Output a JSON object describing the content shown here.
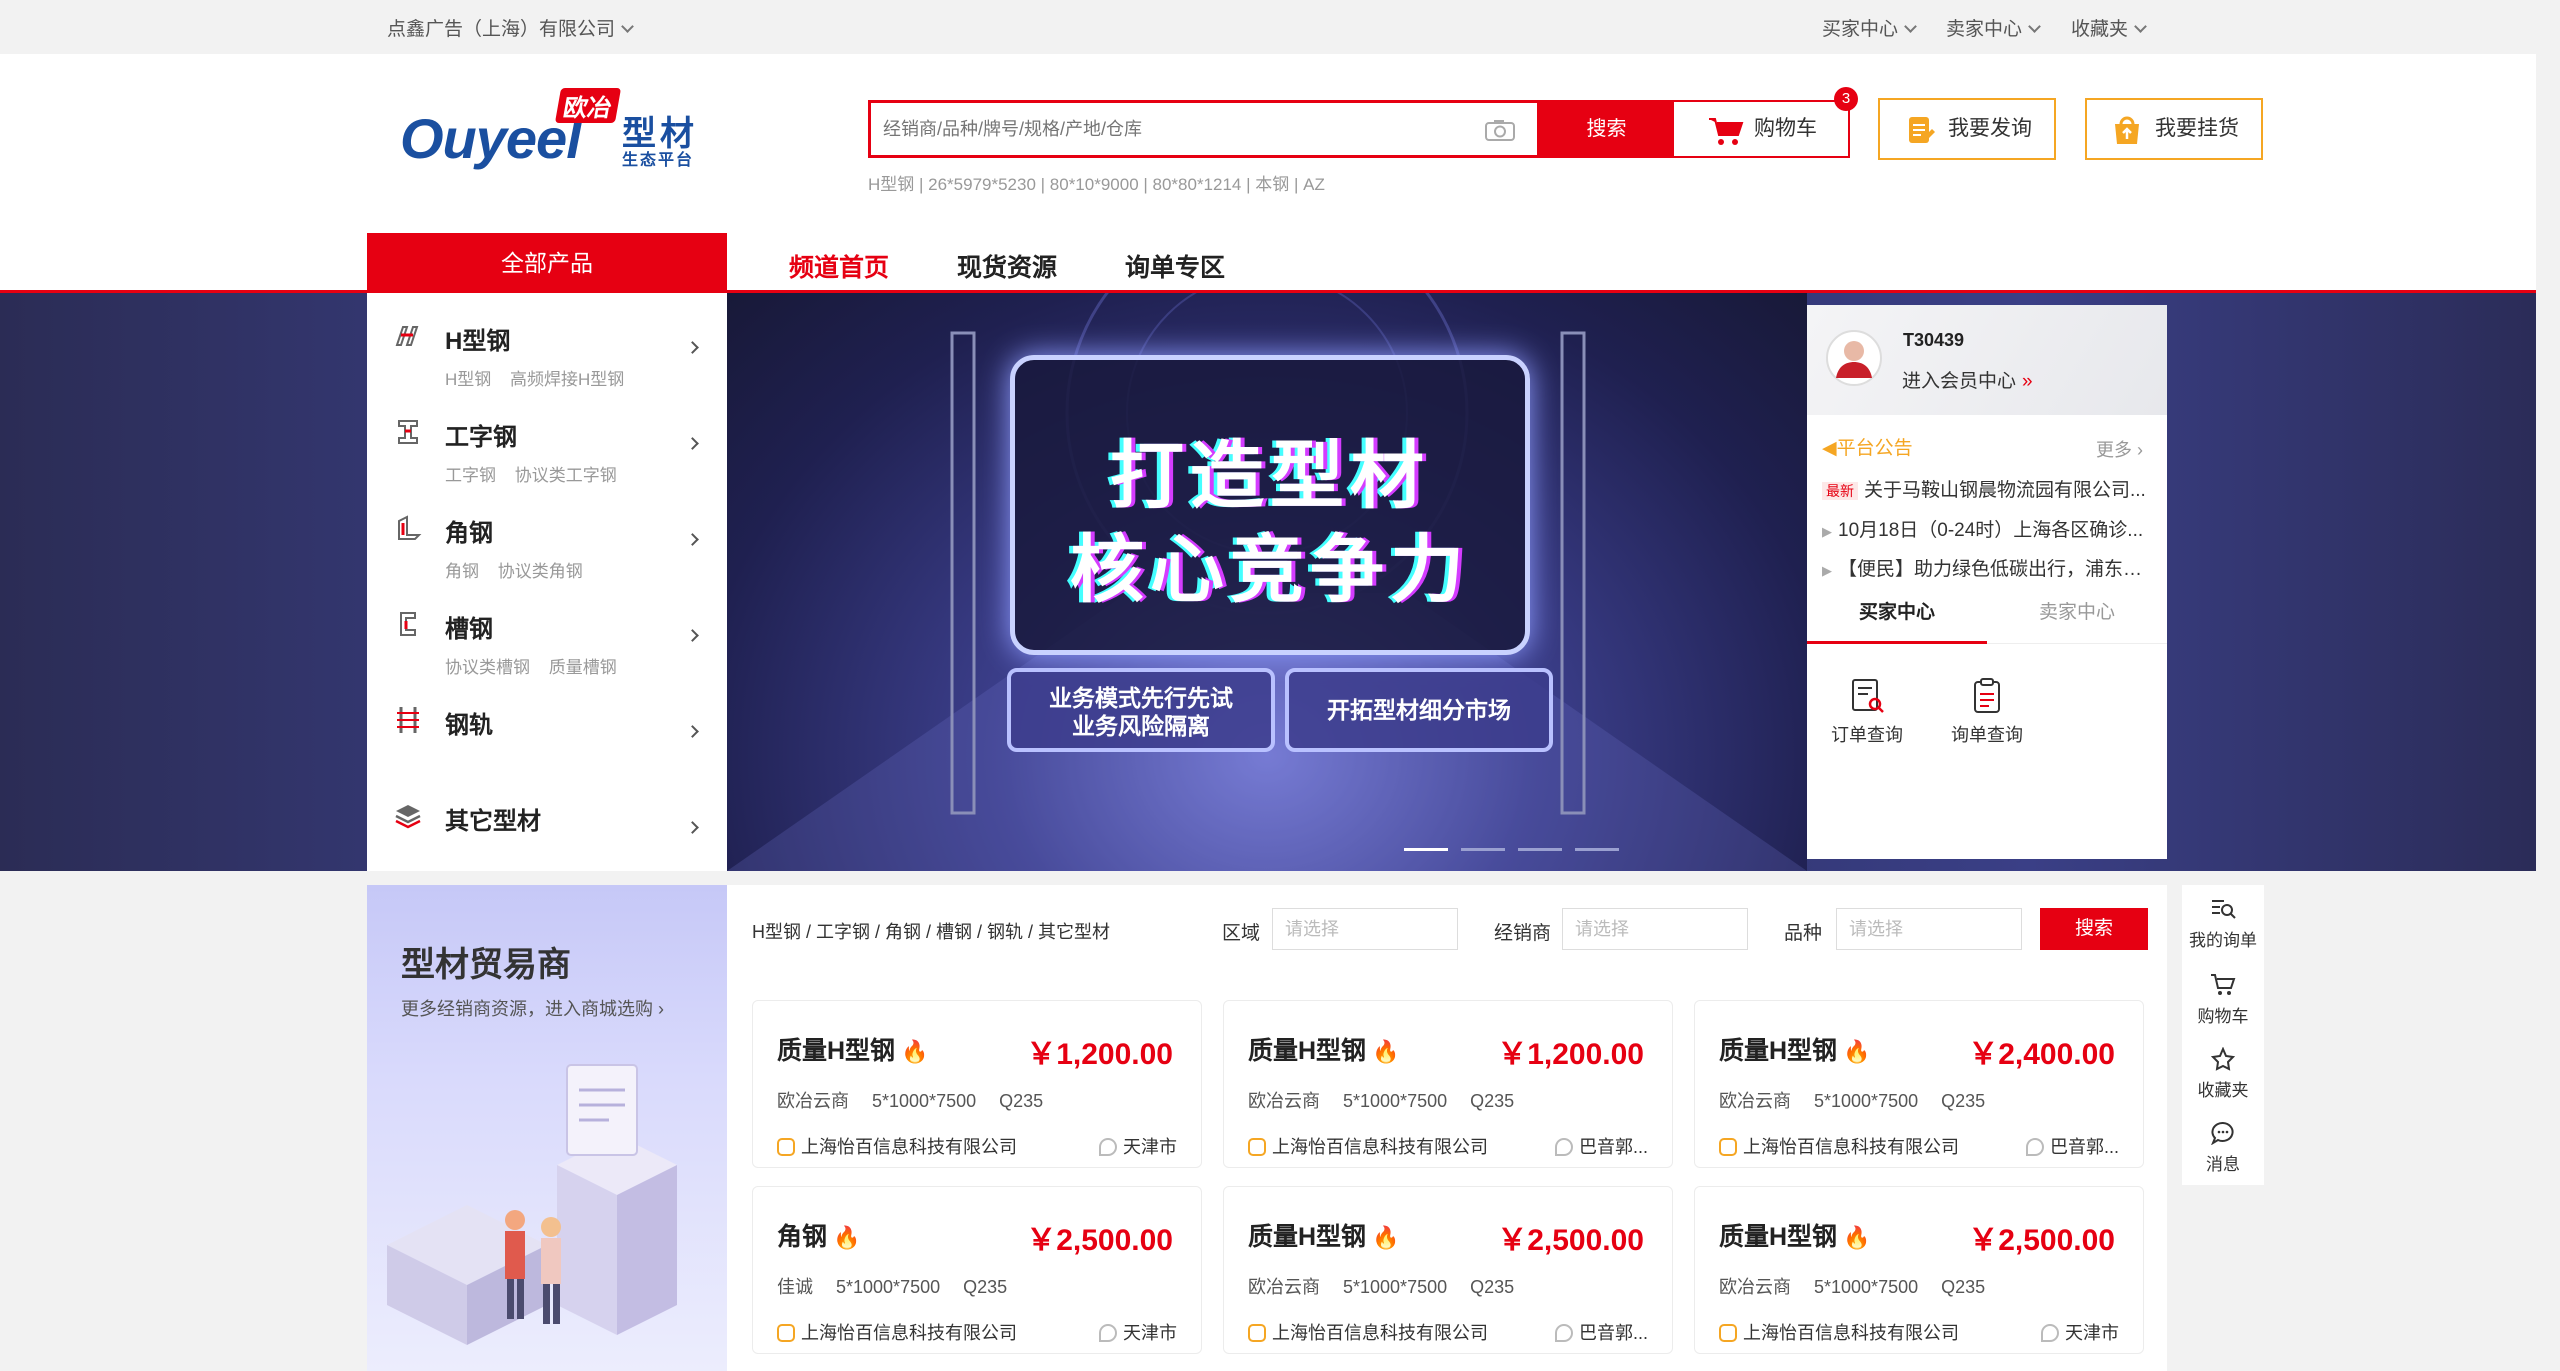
{
  "topbar": {
    "company": "点鑫广告（上海）有限公司",
    "links": [
      "买家中心",
      "卖家中心",
      "收藏夹"
    ]
  },
  "logo": {
    "brand_cn": "欧冶",
    "brand_en": "Ouyeel",
    "product": "型材",
    "tagline": "生态平台"
  },
  "search": {
    "placeholder": "经销商/品种/牌号/规格/产地/仓库",
    "button": "搜索",
    "hotwords": "H型钢 | 26*5979*5230 | 80*10*9000 | 80*80*1214 | 本钢 | AZ"
  },
  "cart": {
    "label": "购物车",
    "count": "3"
  },
  "actions": {
    "inquiry": "我要发询",
    "listing": "我要挂货"
  },
  "nav": {
    "all_products": "全部产品",
    "links": [
      "频道首页",
      "现货资源",
      "询单专区"
    ]
  },
  "categories": [
    {
      "name": "H型钢",
      "sub": "H型钢 高频焊接H型钢"
    },
    {
      "name": "工字钢",
      "sub": "工字钢 协议类工字钢"
    },
    {
      "name": "角钢",
      "sub": "角钢 协议类角钢"
    },
    {
      "name": "槽钢",
      "sub": "协议类槽钢 质量槽钢"
    },
    {
      "name": "钢轨",
      "sub": ""
    },
    {
      "name": "其它型材",
      "sub": ""
    }
  ],
  "banner": {
    "line1": "打造型材",
    "line2": "核心竞争力",
    "tag1_a": "业务模式先行先试",
    "tag1_b": "业务风险隔离",
    "tag2": "开拓型材细分市场"
  },
  "user": {
    "id": "T30439",
    "member_link": "进入会员中心",
    "notice_title": "平台公告",
    "more": "更多",
    "notices": [
      {
        "tag": "最新",
        "text": "关于马鞍山钢晨物流园有限公司..."
      },
      {
        "tag": "",
        "text": "10月18日（0-24时）上海各区确诊..."
      },
      {
        "tag": "",
        "text": "【便民】助力绿色低碳出行，浦东这..."
      }
    ],
    "tabs": [
      "买家中心",
      "卖家中心"
    ],
    "quick": [
      "订单查询",
      "询单查询"
    ]
  },
  "trader": {
    "title": "型材贸易商",
    "subtitle": "更多经销商资源，进入商城选购"
  },
  "filter": {
    "breadcrumb": "H型钢 / 工字钢 / 角钢 / 槽钢 / 钢轨 / 其它型材",
    "region_label": "区域",
    "dealer_label": "经销商",
    "variety_label": "品种",
    "placeholder": "请选择",
    "search": "搜索"
  },
  "products": [
    {
      "title": "质量H型钢",
      "price": "￥1,200.00",
      "specs": "欧冶云商 5*1000*7500 Q235",
      "shop": "上海怡百信息科技有限公司",
      "city": "天津市"
    },
    {
      "title": "质量H型钢",
      "price": "￥1,200.00",
      "specs": "欧冶云商 5*1000*7500 Q235",
      "shop": "上海怡百信息科技有限公司",
      "city": "巴音郭..."
    },
    {
      "title": "质量H型钢",
      "price": "￥2,400.00",
      "specs": "欧冶云商 5*1000*7500 Q235",
      "shop": "上海怡百信息科技有限公司",
      "city": "巴音郭..."
    },
    {
      "title": "角钢",
      "price": "￥2,500.00",
      "specs": "佳诚 5*1000*7500 Q235",
      "shop": "上海怡百信息科技有限公司",
      "city": "天津市"
    },
    {
      "title": "质量H型钢",
      "price": "￥2,500.00",
      "specs": "欧冶云商 5*1000*7500 Q235",
      "shop": "上海怡百信息科技有限公司",
      "city": "巴音郭..."
    },
    {
      "title": "质量H型钢",
      "price": "￥2,500.00",
      "specs": "欧冶云商 5*1000*7500 Q235",
      "shop": "上海怡百信息科技有限公司",
      "city": "天津市"
    }
  ],
  "floatbar": [
    "我的询单",
    "购物车",
    "收藏夹",
    "消息"
  ],
  "colors": {
    "brand_red": "#e60012",
    "accent_orange": "#f5a623",
    "banner_blue": "#363a78"
  }
}
